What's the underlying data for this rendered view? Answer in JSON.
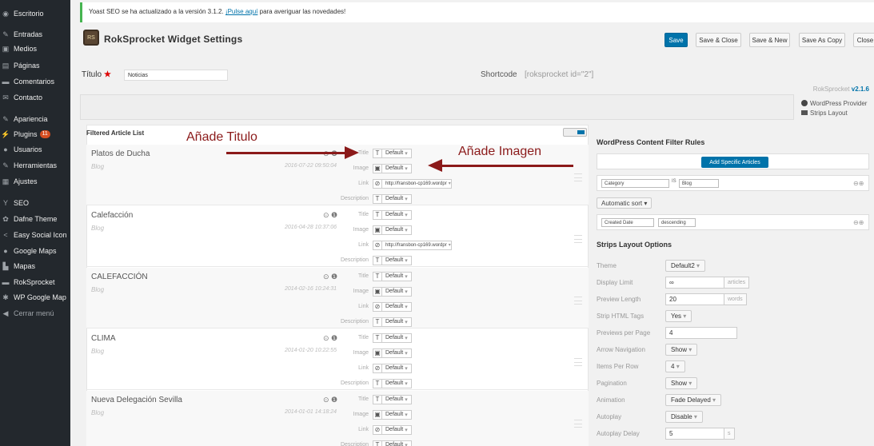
{
  "sidebar": {
    "items": [
      {
        "label": "Escritorio",
        "icon": "dashboard-icon",
        "glyph": "◉"
      },
      {
        "label": "Entradas",
        "icon": "pin-icon",
        "glyph": "✎"
      },
      {
        "label": "Medios",
        "icon": "media-icon",
        "glyph": "▣"
      },
      {
        "label": "Páginas",
        "icon": "pages-icon",
        "glyph": "▤"
      },
      {
        "label": "Comentarios",
        "icon": "comments-icon",
        "glyph": "▬"
      },
      {
        "label": "Contacto",
        "icon": "mail-icon",
        "glyph": "✉"
      },
      {
        "label": "Apariencia",
        "icon": "appearance-icon",
        "glyph": "✎"
      },
      {
        "label": "Plugins",
        "icon": "plugins-icon",
        "glyph": "⚡",
        "badge": "11"
      },
      {
        "label": "Usuarios",
        "icon": "users-icon",
        "glyph": "●"
      },
      {
        "label": "Herramientas",
        "icon": "tools-icon",
        "glyph": "✎"
      },
      {
        "label": "Ajustes",
        "icon": "settings-icon",
        "glyph": "▦"
      },
      {
        "label": "SEO",
        "icon": "seo-icon",
        "glyph": "Y"
      },
      {
        "label": "Dafne Theme",
        "icon": "theme-icon",
        "glyph": "✿"
      },
      {
        "label": "Easy Social Icon",
        "icon": "social-icon",
        "glyph": "<"
      },
      {
        "label": "Google Maps",
        "icon": "map-pin-icon",
        "glyph": "●"
      },
      {
        "label": "Mapas",
        "icon": "maps-icon",
        "glyph": "▙"
      },
      {
        "label": "RokSprocket",
        "icon": "roksprocket-icon",
        "glyph": "▬"
      },
      {
        "label": "WP Google Map",
        "icon": "gear-icon",
        "glyph": "✱"
      },
      {
        "label": "Cerrar menú",
        "icon": "collapse-icon",
        "glyph": "◀"
      }
    ]
  },
  "notice": {
    "text": "Yoast SEO se ha actualizado a la versión 3.1.2. ",
    "link": "¡Pulse aquí",
    "after": " para averiguar las novedades!"
  },
  "header": {
    "title": "RokSprocket Widget Settings",
    "logo": "RS",
    "buttons": {
      "save": "Save",
      "save_close": "Save & Close",
      "save_new": "Save & New",
      "save_copy": "Save As Copy",
      "close": "Close"
    }
  },
  "form": {
    "titulo_label": "Título",
    "required": "★",
    "titulo_value": "Noticias",
    "shortcode_label": "Shortcode",
    "shortcode_value": "[roksprocket id=\"2\"]"
  },
  "version": {
    "prefix": "RokSprocket ",
    "num": "v2.1.6"
  },
  "provider": {
    "name": "WordPress Provider",
    "layout": "Strips Layout"
  },
  "list": {
    "title": "Filtered Article List",
    "field_labels": {
      "title": "Title",
      "image": "Image",
      "link": "Link",
      "description": "Description"
    },
    "default_label": "Default",
    "link_value": "http://fransbon-cp169.wordpr",
    "rows": [
      {
        "title": "Platos de Ducha",
        "category": "Blog",
        "date": "2016-07-22 09:50:04",
        "link": true
      },
      {
        "title": "Calefacción",
        "category": "Blog",
        "date": "2016-04-28 10:37:06",
        "link": true
      },
      {
        "title": "CALEFACCIÓN",
        "category": "Blog",
        "date": "2014-02-16 10:24:31",
        "link": false
      },
      {
        "title": "CLIMA",
        "category": "Blog",
        "date": "2014-01-20 10:22:55",
        "link": false
      },
      {
        "title": "Nueva Delegación Sevilla",
        "category": "Blog",
        "date": "2014-01-01 14:18:24",
        "link": false
      }
    ]
  },
  "annotations": {
    "titulo": "Añade Titulo",
    "imagen": "Añade Imagen"
  },
  "filters": {
    "heading": "WordPress Content Filter Rules",
    "add_button": "Add Specific Articles",
    "rule1": {
      "field": "Category",
      "op": "IS",
      "value": "Blog"
    },
    "sort_button": "Automatic sort",
    "rule2": {
      "field": "Created Date",
      "order": "descending"
    }
  },
  "layout_options": {
    "heading": "Strips Layout Options",
    "theme": {
      "label": "Theme",
      "value": "Default2"
    },
    "display_limit": {
      "label": "Display Limit",
      "value": "∞",
      "unit": "articles"
    },
    "preview_length": {
      "label": "Preview Length",
      "value": "20",
      "unit": "words"
    },
    "strip_html": {
      "label": "Strip HTML Tags",
      "value": "Yes"
    },
    "previews_per_page": {
      "label": "Previews per Page",
      "value": "4"
    },
    "arrow_nav": {
      "label": "Arrow Navigation",
      "value": "Show"
    },
    "items_per_row": {
      "label": "Items Per Row",
      "value": "4"
    },
    "pagination": {
      "label": "Pagination",
      "value": "Show"
    },
    "animation": {
      "label": "Animation",
      "value": "Fade Delayed"
    },
    "autoplay": {
      "label": "Autoplay",
      "value": "Disable"
    },
    "autoplay_delay": {
      "label": "Autoplay Delay",
      "value": "5",
      "unit": "s"
    }
  },
  "colors": {
    "accent": "#0073aa",
    "sidebar": "#23282d",
    "annotation": "#8b1a1a",
    "notice_border": "#46b450"
  }
}
